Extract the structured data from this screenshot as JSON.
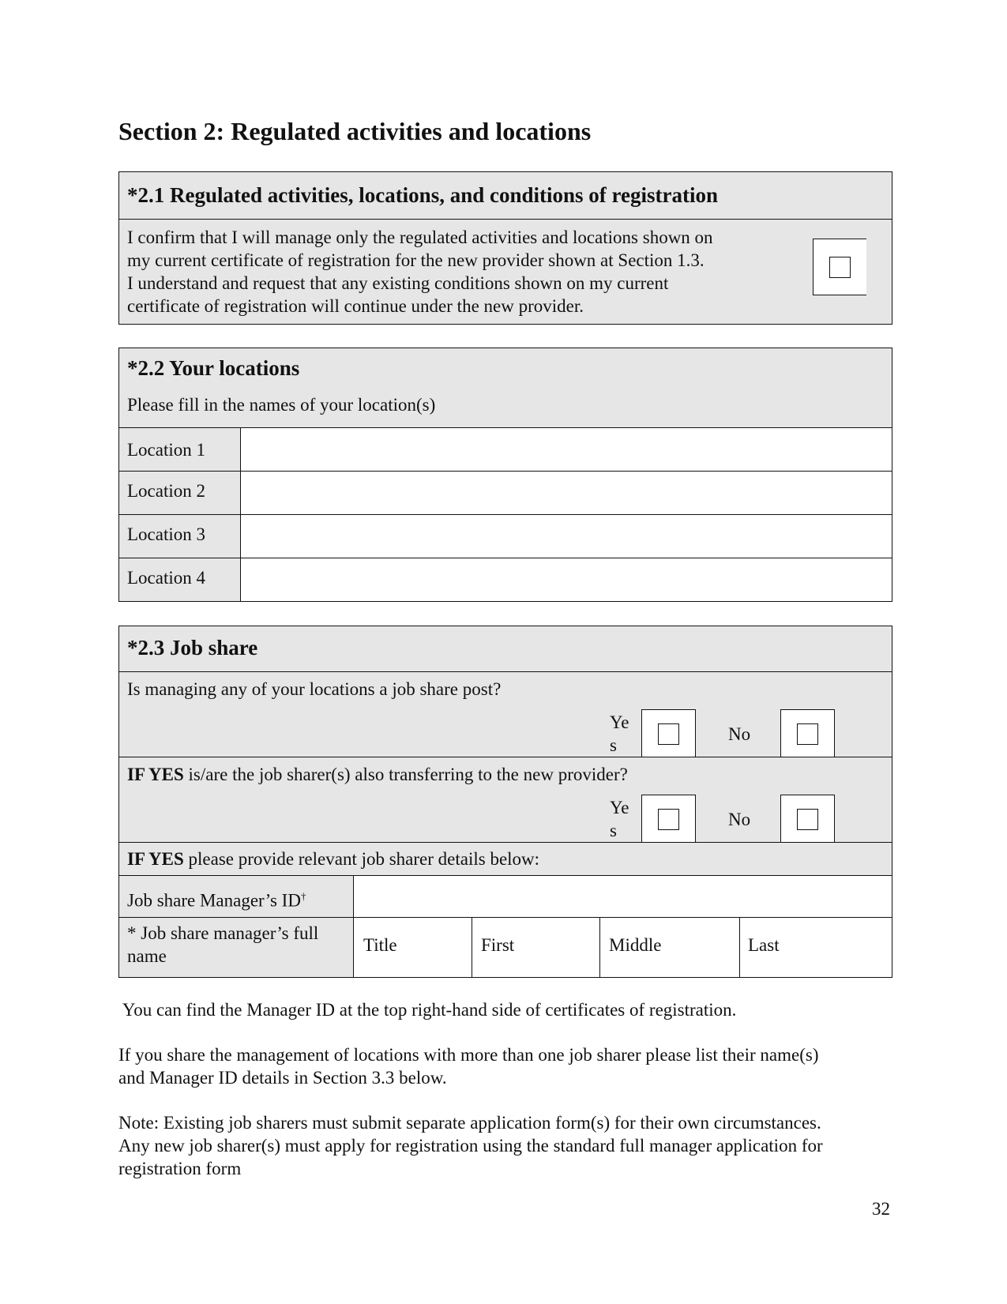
{
  "section_title": "Section 2: Regulated activities and locations",
  "s21": {
    "heading": "*2.1  Regulated activities, locations, and conditions of registration",
    "lines": [
      "I confirm that I will manage only the regulated activities and locations shown on",
      "my current certificate of registration for the new provider shown at Section 1.3.",
      "I understand and request that any existing conditions shown on my current",
      "certificate of registration will continue under the new provider."
    ],
    "confirm_checked": false
  },
  "s22": {
    "heading": "*2.2  Your locations",
    "subheading": "Please fill in the names of your location(s)",
    "rows": [
      {
        "label": "Location 1",
        "value": ""
      },
      {
        "label": "Location 2",
        "value": ""
      },
      {
        "label": "Location 3",
        "value": ""
      },
      {
        "label": "Location 4",
        "value": ""
      }
    ]
  },
  "s23": {
    "heading": "*2.3  Job share",
    "q1": {
      "text": "Is managing any of your locations a job share post?",
      "yes_label_1": "Ye",
      "yes_label_2": "s",
      "no_label": "No"
    },
    "q2": {
      "bold": "IF YES",
      "text": " is/are the job sharer(s) also transferring to the new provider?",
      "yes_label_1": "Ye",
      "yes_label_2": "s",
      "no_label": "No"
    },
    "q3": {
      "bold": "IF YES",
      "text": " please provide relevant job sharer details below:"
    },
    "id_label": "Job share Manager’s ID",
    "id_mark": "†",
    "id_value": "",
    "name_label_1": "* Job share manager’s full",
    "name_label_2": "name",
    "name_fields": [
      "Title",
      "First",
      "Middle",
      "Last"
    ]
  },
  "notes": {
    "manager_id": " You can find the Manager ID at the top right-hand side of certificates of registration.",
    "multi_1": "If you share the management of locations with more than one job sharer please list their name(s)",
    "multi_2": "and Manager ID details in Section 3.3 below.",
    "note_1": "Note: Existing job sharers must submit separate application form(s) for their own circumstances.",
    "note_2": "Any new job sharer(s) must apply for registration using the standard full manager application for",
    "note_3": "registration form"
  },
  "page_number": "32"
}
